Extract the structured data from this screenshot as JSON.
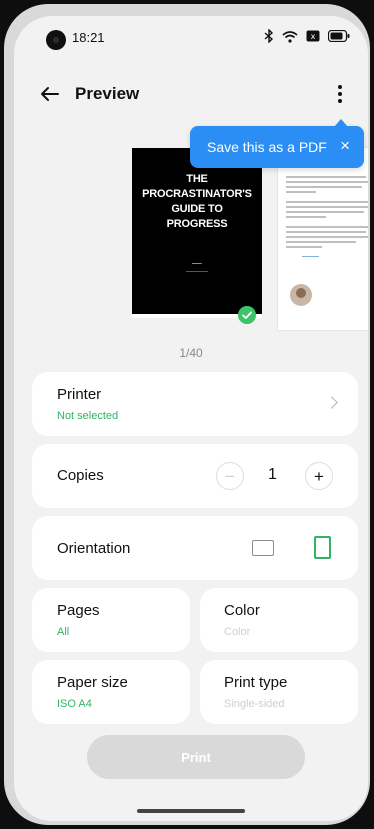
{
  "status_bar": {
    "time": "18:21"
  },
  "header": {
    "title": "Preview"
  },
  "tooltip": {
    "text": "Save this as a PDF",
    "close": "×"
  },
  "preview": {
    "cover_title": "THE PROCRASTINATOR'S GUIDE TO PROGRESS",
    "page_count": "1/40"
  },
  "printer": {
    "label": "Printer",
    "value": "Not selected"
  },
  "copies": {
    "label": "Copies",
    "value": "1",
    "minus": "−",
    "plus": "+"
  },
  "orientation": {
    "label": "Orientation",
    "selected": "portrait"
  },
  "pages": {
    "label": "Pages",
    "value": "All"
  },
  "color": {
    "label": "Color",
    "value": "Color"
  },
  "paper_size": {
    "label": "Paper size",
    "value": "ISO A4"
  },
  "print_type": {
    "label": "Print type",
    "value": "Single-sided"
  },
  "print_button": {
    "label": "Print",
    "enabled": false
  },
  "colors": {
    "accent": "#2fb463",
    "tooltip": "#2a8ef5",
    "background": "#f2f2f2"
  }
}
